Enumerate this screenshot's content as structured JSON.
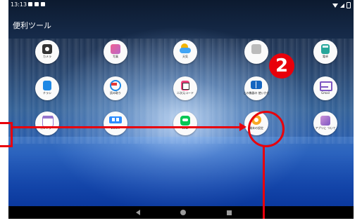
{
  "status_bar": {
    "time": "13:13"
  },
  "folder": {
    "title": "便利ツール"
  },
  "apps": [
    {
      "label": "カメラ",
      "icon": "camera-icon"
    },
    {
      "label": "写真",
      "icon": "photos-icon"
    },
    {
      "label": "天気",
      "icon": "weather-icon"
    },
    {
      "label": "",
      "icon": "app-icon"
    },
    {
      "label": "電卓",
      "icon": "calculator-icon"
    },
    {
      "label": "チラシ",
      "icon": "flyer-icon"
    },
    {
      "label": "読み取り",
      "icon": "reader-icon"
    },
    {
      "label": "二次元コード",
      "icon": "qr-code-icon"
    },
    {
      "label": "この機器の 使いかた",
      "icon": "manual-icon"
    },
    {
      "label": "Gmail",
      "icon": "gmail-icon"
    },
    {
      "label": "カレンダー",
      "icon": "calendar-icon"
    },
    {
      "label": "ZOOM",
      "icon": "zoom-icon"
    },
    {
      "label": "LINE",
      "icon": "line-icon"
    },
    {
      "label": "端末の設定",
      "icon": "settings-gear-icon"
    },
    {
      "label": "アプリに ついて",
      "icon": "about-app-icon"
    }
  ],
  "annotation": {
    "step_number": "2",
    "color": "#e8000b"
  },
  "navigation_bar": {
    "back": "back-icon",
    "home": "home-icon",
    "recents": "recents-icon"
  }
}
